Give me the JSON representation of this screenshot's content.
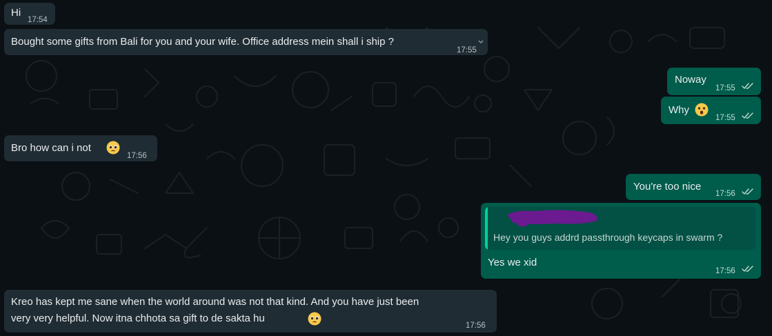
{
  "colors": {
    "background": "#0b1014",
    "incoming_bubble": "#202c33",
    "outgoing_bubble": "#005c4b",
    "read_tick": "#c2dcd4",
    "quote_accent": "#06cf9c",
    "redaction": "#6b1a8f"
  },
  "messages": [
    {
      "text": "Hi",
      "time": "17:54"
    },
    {
      "text": "Bought some gifts from Bali for you and your wife. Office address mein shall i ship ?",
      "time": "17:55"
    },
    {
      "text": "Noway",
      "time": "17:55",
      "status_icon": "double-check-icon"
    },
    {
      "text": "Why",
      "time": "17:55",
      "emoji": "astonished-face",
      "status_icon": "double-check-icon"
    },
    {
      "text": "Bro how can i not",
      "time": "17:56",
      "emoji": "pleading-face"
    },
    {
      "text": "You're too nice",
      "time": "17:56",
      "status_icon": "double-check-icon"
    },
    {
      "quoted_text": "Hey you guys addrd passthrough keycaps in swarm ?",
      "text": "Yes we xid",
      "time": "17:56",
      "status_icon": "double-check-icon"
    },
    {
      "text_line1": "Kreo has kept me sane when the world around was not that kind. And you have just been",
      "text_line2": "very very helpful. Now itna chhota sa gift to de sakta hu",
      "time": "17:56",
      "emoji": "pleading-face"
    }
  ]
}
